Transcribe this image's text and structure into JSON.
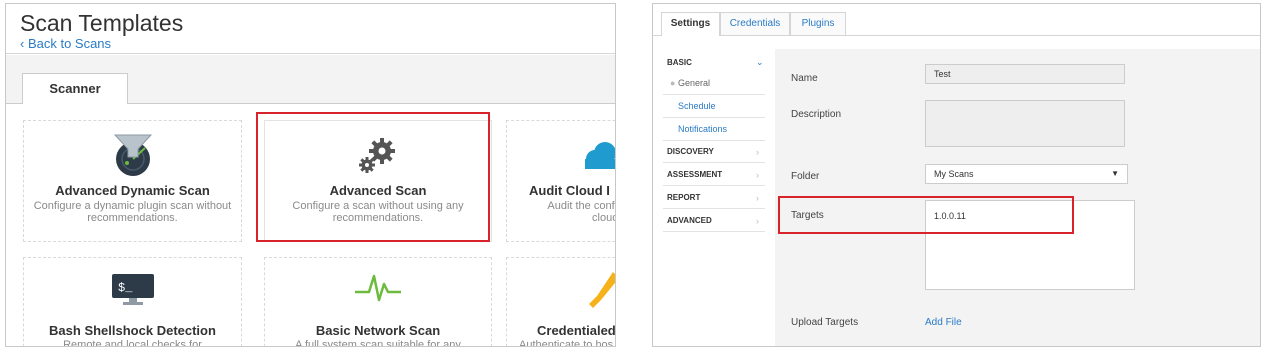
{
  "left_panel": {
    "title": "Scan Templates",
    "back_link": "‹ Back to Scans",
    "tab": "Scanner",
    "cards": [
      {
        "title": "Advanced Dynamic Scan",
        "desc": "Configure a dynamic plugin scan without recommendations.",
        "icon": "radar-funnel-icon"
      },
      {
        "title": "Advanced Scan",
        "desc": "Configure a scan without using any recommendations.",
        "icon": "gears-icon"
      },
      {
        "title": "Audit Cloud I",
        "desc": "Audit the configur cloud se",
        "icon": "cloud-icon"
      },
      {
        "title": "Bash Shellshock Detection",
        "desc": "Remote and local checks for",
        "icon": "terminal-icon"
      },
      {
        "title": "Basic Network Scan",
        "desc": "A full system scan suitable for any",
        "icon": "pulse-icon"
      },
      {
        "title": "Credentialed",
        "desc": "Authenticate to hos",
        "icon": "key-icon"
      }
    ]
  },
  "right_panel": {
    "tabs": [
      "Settings",
      "Credentials",
      "Plugins"
    ],
    "sidebar": {
      "basic": "BASIC",
      "basic_items": [
        "General",
        "Schedule",
        "Notifications"
      ],
      "sections": [
        "DISCOVERY",
        "ASSESSMENT",
        "REPORT",
        "ADVANCED"
      ]
    },
    "form": {
      "name_label": "Name",
      "name_value": "Test",
      "description_label": "Description",
      "description_value": "",
      "folder_label": "Folder",
      "folder_value": "My Scans",
      "targets_label": "Targets",
      "targets_value": "1.0.0.11",
      "upload_label": "Upload Targets",
      "add_file": "Add File"
    }
  },
  "colors": {
    "accent": "#2a7bc6",
    "highlight": "#d9232a",
    "icon_dark": "#2d3a48",
    "icon_green": "#6dbb3e",
    "cloud": "#1f9bd0",
    "key": "#f5b21b"
  }
}
